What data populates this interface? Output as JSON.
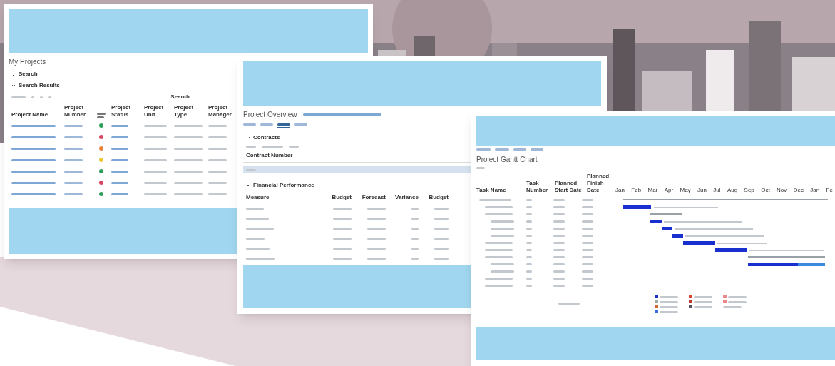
{
  "projects": {
    "title": "My Projects",
    "sections": [
      "Search",
      "Search Results"
    ],
    "search_button": "Search",
    "columns": [
      "Project Name",
      "Project Number",
      "Project Status",
      "Project Unit",
      "Project Type",
      "Project Manager"
    ],
    "rows": [
      {
        "color": "#2e9e5b"
      },
      {
        "color": "#d9455f"
      },
      {
        "color": "#e8833a"
      },
      {
        "color": "#e8c93a"
      },
      {
        "color": "#2e9e5b"
      },
      {
        "color": "#d9455f"
      },
      {
        "color": "#2e9e5b"
      }
    ]
  },
  "overview": {
    "title": "Project Overview",
    "tabs": [
      {
        "selected": false
      },
      {
        "selected": false
      },
      {
        "selected": true
      },
      {
        "selected": false
      }
    ],
    "contracts": {
      "heading": "Contracts",
      "column": "Contract Number",
      "rows": [
        {
          "selected": true
        }
      ]
    },
    "financial": {
      "heading": "Financial Performance",
      "columns": [
        "Measure",
        "Budget",
        "Forecast",
        "Variance",
        "Budget"
      ]
    }
  },
  "gantt": {
    "title": "Project Gantt Chart",
    "columns": [
      "Task Name",
      "Task Number",
      "Planned Start Date",
      "Planned Finish Date"
    ],
    "months": [
      "Jan",
      "Feb",
      "Mar",
      "Apr",
      "May",
      "Jun",
      "Jul",
      "Aug",
      "Sep",
      "Oct",
      "Nov",
      "Dec",
      "Jan",
      "Fe"
    ]
  }
}
